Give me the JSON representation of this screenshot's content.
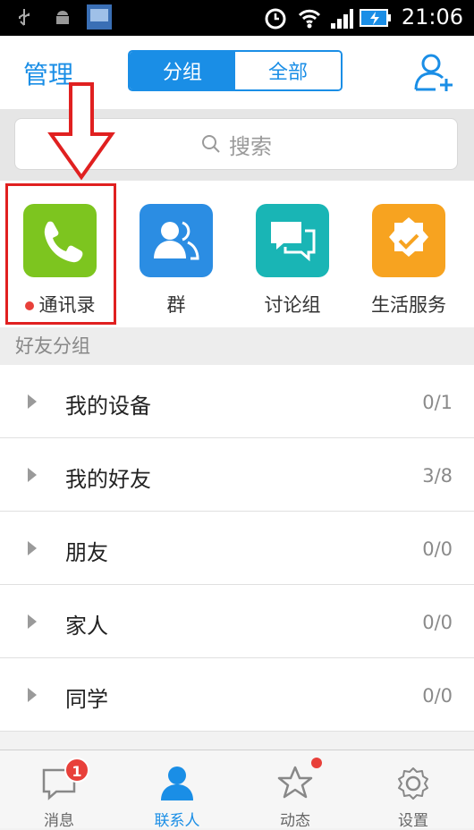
{
  "status_bar": {
    "time": "21:06"
  },
  "header": {
    "manage_label": "管理",
    "segments": [
      "分组",
      "全部"
    ]
  },
  "search": {
    "placeholder": "搜索"
  },
  "quick_actions": [
    {
      "label": "通讯录",
      "color": "#7dc51f"
    },
    {
      "label": "群",
      "color": "#2b8de3"
    },
    {
      "label": "讨论组",
      "color": "#19b5b5"
    },
    {
      "label": "生活服务",
      "color": "#f7a320"
    }
  ],
  "group_header": "好友分组",
  "groups": [
    {
      "name": "我的设备",
      "count": "0/1"
    },
    {
      "name": "我的好友",
      "count": "3/8"
    },
    {
      "name": "朋友",
      "count": "0/0"
    },
    {
      "name": "家人",
      "count": "0/0"
    },
    {
      "name": "同学",
      "count": "0/0"
    }
  ],
  "tabs": [
    {
      "label": "消息",
      "badge": "1"
    },
    {
      "label": "联系人"
    },
    {
      "label": "动态"
    },
    {
      "label": "设置"
    }
  ],
  "colors": {
    "accent": "#1a8ee6",
    "badge": "#e8403a",
    "annotation": "#e02020"
  }
}
